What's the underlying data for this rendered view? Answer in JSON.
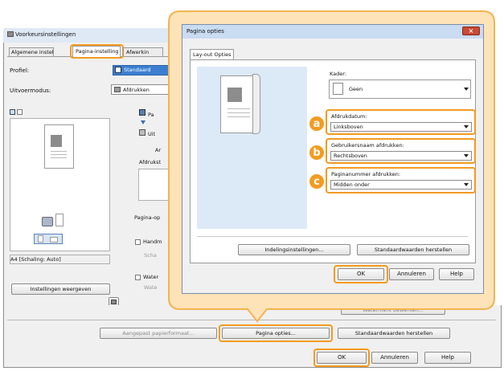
{
  "back_window": {
    "title": "Voorkeursinstellingen",
    "tabs": [
      "Algemene instellinge",
      "Pagina-instelling",
      "Afwerkin"
    ],
    "profile_label": "Profiel:",
    "profile_value": "Standaard",
    "output_label": "Uitvoermodus:",
    "output_value": "Afdrukken",
    "side_label_pa": "Pa",
    "side_label_uit": "Uit",
    "side_label_ar": "Ar",
    "side_label_afdrukst": "Afdrukst",
    "pagina_op_label": "Pagina-op",
    "handm_label": "Handm",
    "schaal_label": "Scha",
    "watermark_label": "Water",
    "water2_label": "Wate",
    "status_text": "A4 [Schaling: Auto]",
    "view_settings_button": "Instellingen weergeven",
    "hidden_button_label": "Watermerk bewerken...",
    "custom_size_button": "Aangepast papierformaat...",
    "page_options_button": "Pagina opties...",
    "restore_defaults_button": "Standaardwaarden herstellen",
    "ok_button": "OK",
    "cancel_button": "Annuleren",
    "help_button": "Help"
  },
  "dialog": {
    "title": "Pagina opties",
    "tab": "Lay-out Opties",
    "frame_label": "Kader:",
    "frame_value": "Geen",
    "print_date_label": "Afdrukdatum:",
    "print_date_value": "Linksboven",
    "print_user_label": "Gebruikersnaam afdrukken:",
    "print_user_value": "Rechtsboven",
    "page_number_label": "Paginanummer afdrukken:",
    "page_number_value": "Midden onder",
    "layout_settings_button": "Indelingsinstellingen...",
    "restore_defaults_button": "Standaardwaarden herstellen",
    "ok_button": "OK",
    "cancel_button": "Annuleren",
    "help_button": "Help"
  },
  "badges": [
    "a",
    "b",
    "c"
  ],
  "colors": {
    "highlight": "#f39b21",
    "callout_fill": "#fde3b7",
    "dialog_title_bar": "#c9dcf2",
    "close_button": "#c94a35"
  }
}
